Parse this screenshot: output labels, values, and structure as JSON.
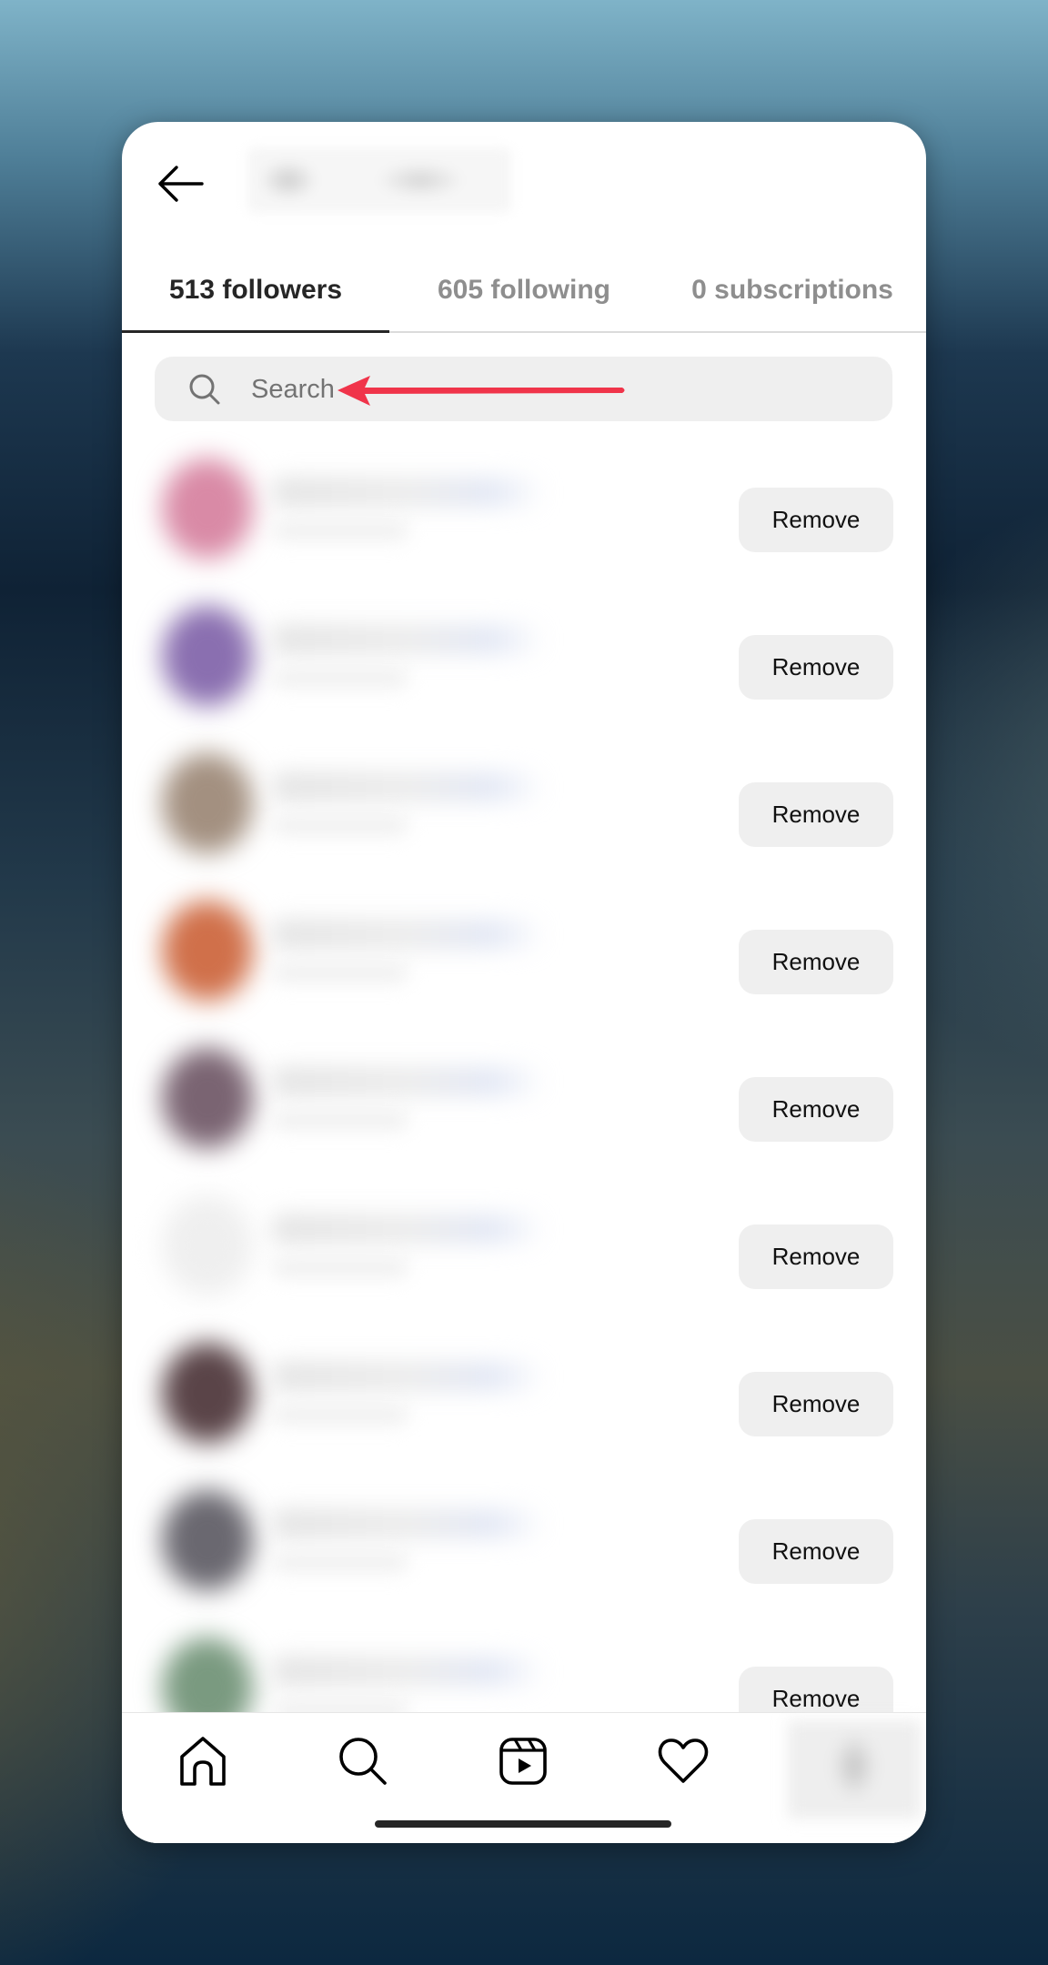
{
  "header": {
    "back_icon": "arrow-left-icon",
    "title": "(username blurred)"
  },
  "tabs": [
    {
      "label": "513 followers",
      "active": true
    },
    {
      "label": "605 following",
      "active": false
    },
    {
      "label": "0 subscriptions",
      "active": false
    }
  ],
  "search": {
    "icon": "search-icon",
    "placeholder": "Search",
    "value": ""
  },
  "annotation": {
    "type": "red-arrow",
    "color": "#f0344a",
    "points_to": "search-input"
  },
  "followers": [
    {
      "username": "(blurred)",
      "avatar_color": "#d98aa6",
      "action": "Remove"
    },
    {
      "username": "(blurred)",
      "avatar_color": "#8a6fb0",
      "action": "Remove"
    },
    {
      "username": "(blurred)",
      "avatar_color": "#a39080",
      "action": "Remove"
    },
    {
      "username": "(blurred)",
      "avatar_color": "#d0704a",
      "action": "Remove"
    },
    {
      "username": "(blurred)",
      "avatar_color": "#7a6472",
      "action": "Remove"
    },
    {
      "username": "(blurred)",
      "avatar_color": "#efefef",
      "action": "Remove"
    },
    {
      "username": "(blurred)",
      "avatar_color": "#5a4448",
      "action": "Remove"
    },
    {
      "username": "(blurred)",
      "avatar_color": "#6a6870",
      "action": "Remove"
    },
    {
      "username": "(blurred)",
      "avatar_color": "#7a9a80",
      "action": "Remove"
    }
  ],
  "bottom_nav": [
    {
      "icon": "home-icon",
      "label": "Home"
    },
    {
      "icon": "search-icon",
      "label": "Search"
    },
    {
      "icon": "reels-icon",
      "label": "Reels"
    },
    {
      "icon": "heart-icon",
      "label": "Activity"
    },
    {
      "icon": "profile-avatar",
      "label": "Profile"
    }
  ]
}
